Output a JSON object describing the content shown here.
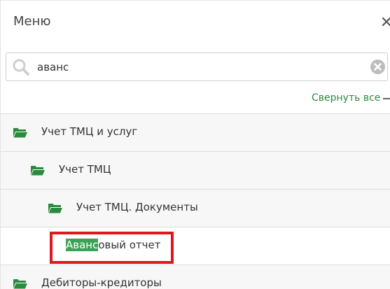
{
  "header": {
    "title": "Меню",
    "close_glyph": "×"
  },
  "search": {
    "value": "аванс"
  },
  "toolbar": {
    "collapse_all": "Свернуть все"
  },
  "tree": [
    {
      "label": "Учет ТМЦ и услуг",
      "level": 0,
      "type": "folder"
    },
    {
      "label": "Учет ТМЦ",
      "level": 1,
      "type": "folder"
    },
    {
      "label": "Учет ТМЦ. Документы",
      "level": 2,
      "type": "folder"
    },
    {
      "label_match": "Аванс",
      "label_rest": "овый отчет",
      "level": 3,
      "type": "item",
      "highlighted": true
    },
    {
      "label": "Дебиторы-кредиторы",
      "level": 0,
      "type": "folder"
    }
  ],
  "colors": {
    "accent_green": "#2a8a3e",
    "match_highlight": "#3aa356",
    "annotation_red": "#e0171f"
  },
  "icons": {
    "folder": "folder-open-icon",
    "search": "search-icon",
    "clear": "clear-icon",
    "close": "close-icon"
  }
}
